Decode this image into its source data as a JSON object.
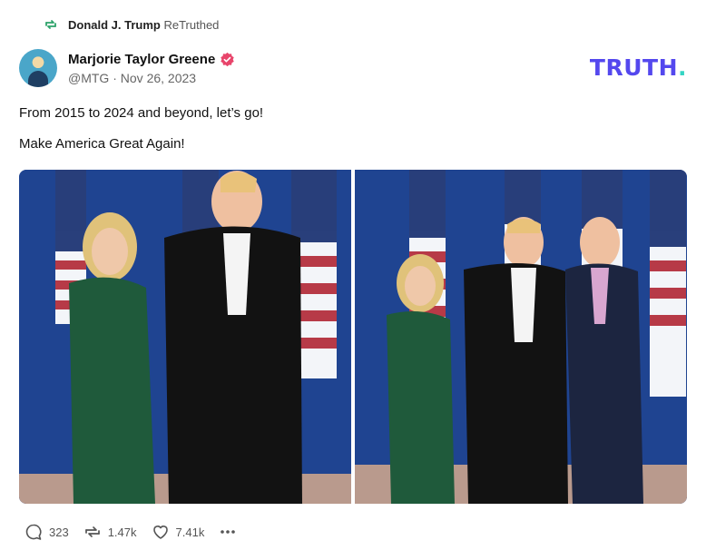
{
  "retruth": {
    "user": "Donald J. Trump",
    "verb": "ReTruthed",
    "icon": "retruth-icon"
  },
  "author": {
    "name": "Marjorie Taylor Greene",
    "handle": "@MTG",
    "separator": "·",
    "date": "Nov 26, 2023",
    "verified_color": "#e8456b"
  },
  "brand": {
    "logo_text": "TRUTH",
    "logo_dot": ".",
    "color": "#5448ee",
    "accent": "#34d5c4"
  },
  "post": {
    "lines": [
      "From 2015 to 2024 and beyond, let’s go!",
      "Make America Great Again!"
    ]
  },
  "media": {
    "images": [
      {
        "name": "photo-mtg-trump"
      },
      {
        "name": "photo-mtg-trump-guest"
      }
    ]
  },
  "actions": {
    "replies": "323",
    "retruths": "1.47k",
    "likes": "7.41k",
    "more_icon": "more-icon"
  }
}
